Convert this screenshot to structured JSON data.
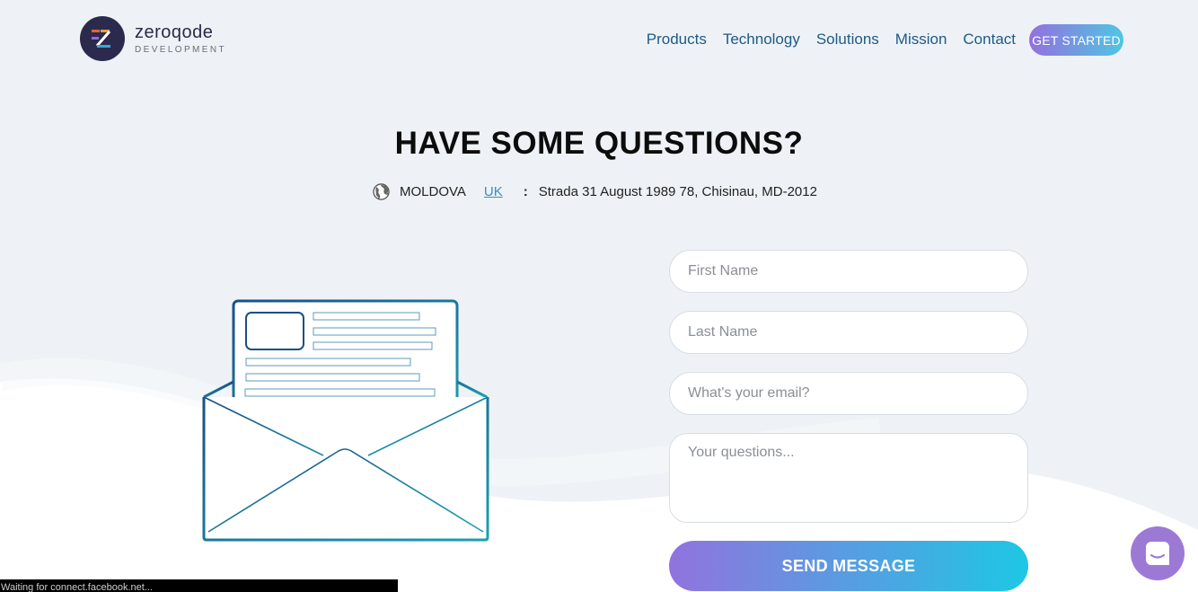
{
  "brand": {
    "name": "zeroqode",
    "subtitle": "DEVELOPMENT"
  },
  "nav": {
    "items": [
      "Products",
      "Technology",
      "Solutions",
      "Mission",
      "Contact"
    ],
    "cta": "GET STARTED"
  },
  "hero": {
    "title": "HAVE SOME QUESTIONS?",
    "location": {
      "country": "MOLDOVA",
      "alt_country": "UK",
      "separator": ":",
      "address": "Strada 31 August 1989 78, Chisinau, MD-2012"
    }
  },
  "form": {
    "first_name_placeholder": "First Name",
    "last_name_placeholder": "Last Name",
    "email_placeholder": "What's your email?",
    "questions_placeholder": "Your questions...",
    "submit_label": "SEND MESSAGE"
  },
  "status_bar": {
    "text": "Waiting for connect.facebook.net..."
  },
  "colors": {
    "background": "#eef2f6",
    "nav_link": "#1e5a86",
    "gradient_start": "#9173de",
    "gradient_end": "#1ec7e4",
    "chat_bubble": "#9d79d6"
  },
  "icons": {
    "location": "globe-icon",
    "chat": "chat-icon",
    "illustration": "open-envelope-icon"
  }
}
